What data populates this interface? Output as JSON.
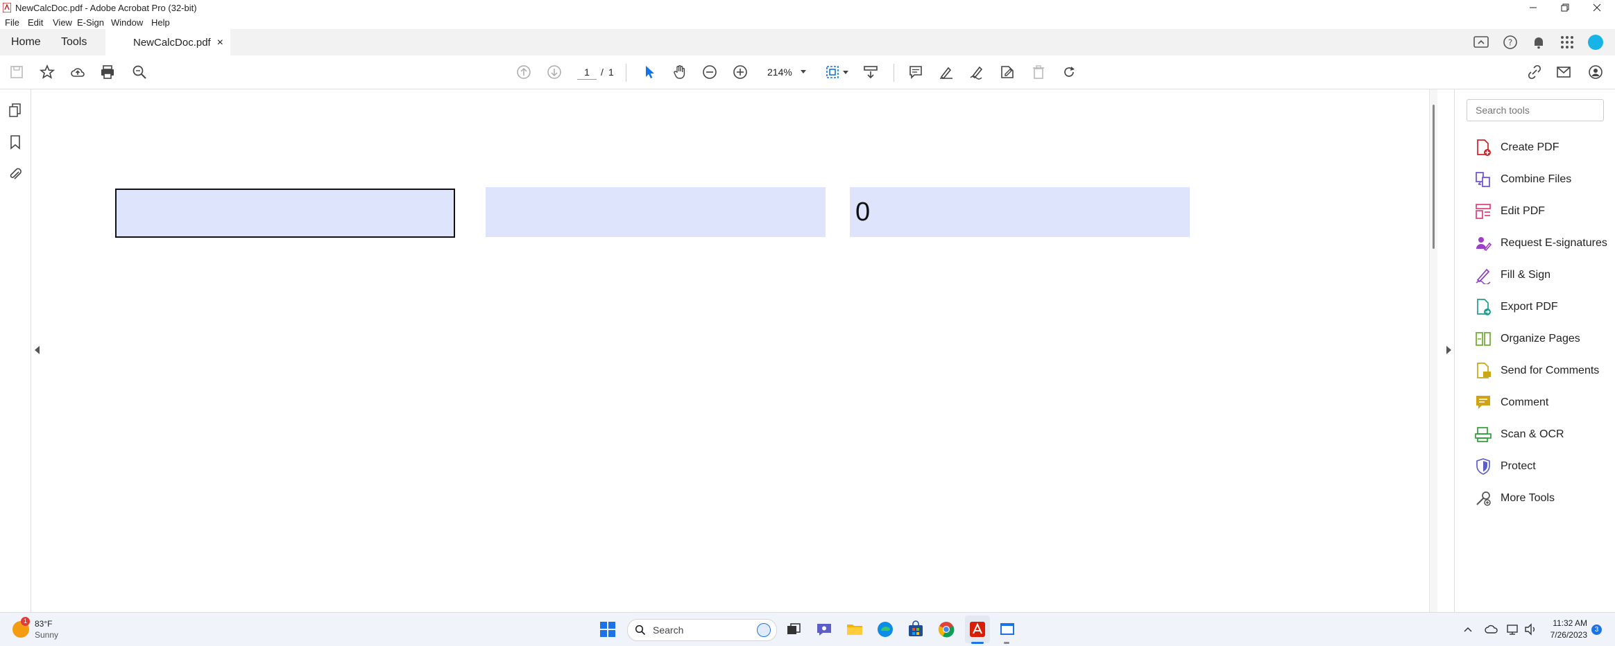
{
  "window": {
    "title": "NewCalcDoc.pdf - Adobe Acrobat Pro (32-bit)"
  },
  "menu": [
    "File",
    "Edit",
    "View",
    "E-Sign",
    "Window",
    "Help"
  ],
  "tabs": {
    "home": "Home",
    "tools": "Tools",
    "doc": "NewCalcDoc.pdf",
    "close": "×"
  },
  "toolbar": {
    "page_current": "1",
    "page_sep": "/",
    "page_total": "1",
    "zoom": "214%"
  },
  "document": {
    "field1_value": "",
    "field2_value": "",
    "field3_value": "0"
  },
  "panel": {
    "search_placeholder": "Search tools",
    "tools": [
      {
        "label": "Create PDF",
        "icon": "create-pdf-icon",
        "color": "#d2232a"
      },
      {
        "label": "Combine Files",
        "icon": "combine-files-icon",
        "color": "#6b4ed6"
      },
      {
        "label": "Edit PDF",
        "icon": "edit-pdf-icon",
        "color": "#d8407a"
      },
      {
        "label": "Request E-signatures",
        "icon": "request-esign-icon",
        "color": "#9c3ec8"
      },
      {
        "label": "Fill & Sign",
        "icon": "fill-sign-icon",
        "color": "#8a3cc4"
      },
      {
        "label": "Export PDF",
        "icon": "export-pdf-icon",
        "color": "#1f9e8d"
      },
      {
        "label": "Organize Pages",
        "icon": "organize-pages-icon",
        "color": "#6ca82c"
      },
      {
        "label": "Send for Comments",
        "icon": "send-comments-icon",
        "color": "#c9a814"
      },
      {
        "label": "Comment",
        "icon": "comment-icon",
        "color": "#d0a316"
      },
      {
        "label": "Scan & OCR",
        "icon": "scan-ocr-icon",
        "color": "#2f9e3a"
      },
      {
        "label": "Protect",
        "icon": "protect-icon",
        "color": "#5a5fc8"
      },
      {
        "label": "More Tools",
        "icon": "more-tools-icon",
        "color": "#555555"
      }
    ]
  },
  "taskbar": {
    "weather_temp": "83°F",
    "weather_desc": "Sunny",
    "weather_badge": "1",
    "search_label": "Search",
    "time": "11:32 AM",
    "date": "7/26/2023",
    "notif_count": "3"
  },
  "colors": {
    "accent": "#1473e6",
    "field_fill": "#dde4fb"
  }
}
